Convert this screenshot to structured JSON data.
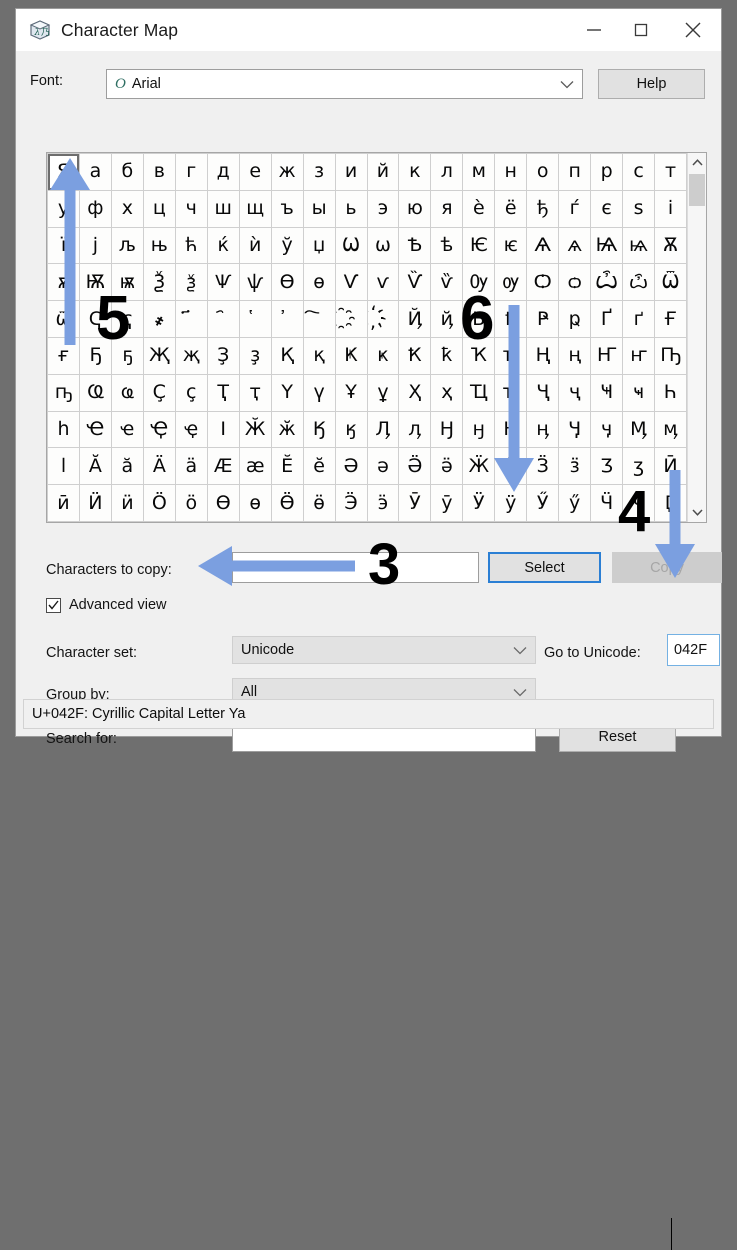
{
  "window": {
    "title": "Character Map",
    "icon": "character-map-icon",
    "controls": {
      "minimize": "minimize-icon",
      "maximize": "maximize-icon",
      "close": "close-icon"
    }
  },
  "font_row": {
    "label": "Font:",
    "value": "Arial",
    "value_prefix_glyph": "O",
    "dropdown_icon": "chevron-down-icon",
    "help_label": "Help"
  },
  "grid": {
    "columns": 20,
    "rows": 10,
    "selected_index": 0,
    "scrollbar": {
      "up_icon": "chevron-up-icon",
      "down_icon": "chevron-down-icon"
    },
    "cells": [
      "Я",
      "а",
      "б",
      "в",
      "г",
      "д",
      "е",
      "ж",
      "з",
      "и",
      "й",
      "к",
      "л",
      "м",
      "н",
      "о",
      "п",
      "р",
      "с",
      "т",
      "у",
      "ф",
      "х",
      "ц",
      "ч",
      "ш",
      "щ",
      "ъ",
      "ы",
      "ь",
      "э",
      "ю",
      "я",
      "ѐ",
      "ё",
      "ђ",
      "ѓ",
      "є",
      "ѕ",
      "і",
      "ї",
      "ј",
      "љ",
      "њ",
      "ћ",
      "ќ",
      "ѝ",
      "ў",
      "џ",
      "Ѡ",
      "ѡ",
      "Ѣ",
      "ѣ",
      "Ѥ",
      "ѥ",
      "Ѧ",
      "ѧ",
      "Ѩ",
      "ѩ",
      "Ѫ",
      "ѫ",
      "Ѭ",
      "ѭ",
      "Ѯ",
      "ѯ",
      "Ѱ",
      "ѱ",
      "Ѳ",
      "ѳ",
      "Ѵ",
      "ѵ",
      "Ѷ",
      "ѷ",
      "Ѹ",
      "ѹ",
      "Ѻ",
      "ѻ",
      "Ѽ",
      "ѽ",
      "Ѿ",
      "ѿ",
      "Ҁ",
      "ҁ",
      "҂",
      "҃",
      "҄",
      "҅",
      "҆",
      "҇",
      "҈",
      "҉",
      "Ҋ",
      "ҋ",
      "Ҍ",
      "ҍ",
      "Ҏ",
      "ҏ",
      "Ґ",
      "ґ",
      "Ғ",
      "ғ",
      "Ҕ",
      "ҕ",
      "Җ",
      "җ",
      "Ҙ",
      "ҙ",
      "Қ",
      "қ",
      "Ҝ",
      "ҝ",
      "Ҟ",
      "ҟ",
      "Ҡ",
      "ҡ",
      "Ң",
      "ң",
      "Ҥ",
      "ҥ",
      "Ҧ",
      "ҧ",
      "Ҩ",
      "ҩ",
      "Ҫ",
      "ҫ",
      "Ҭ",
      "ҭ",
      "Ү",
      "ү",
      "Ұ",
      "ұ",
      "Ҳ",
      "ҳ",
      "Ҵ",
      "ҵ",
      "Ҷ",
      "ҷ",
      "Ҹ",
      "ҹ",
      "Һ",
      "һ",
      "Ҽ",
      "ҽ",
      "Ҿ",
      "ҿ",
      "Ӏ",
      "Ӂ",
      "ӂ",
      "Ӄ",
      "ӄ",
      "Ӆ",
      "ӆ",
      "Ӈ",
      "ӈ",
      "Ӊ",
      "ӊ",
      "Ӌ",
      "ӌ",
      "Ӎ",
      "ӎ",
      "ӏ",
      "Ӑ",
      "ӑ",
      "Ӓ",
      "ӓ",
      "Ӕ",
      "ӕ",
      "Ӗ",
      "ӗ",
      "Ә",
      "ә",
      "Ӛ",
      "ӛ",
      "Ӝ",
      "ӝ",
      "Ӟ",
      "ӟ",
      "Ӡ",
      "ӡ",
      "Ӣ",
      "ӣ",
      "Ӥ",
      "ӥ",
      "Ӧ",
      "ӧ",
      "Ө",
      "ө",
      "Ӫ",
      "ӫ",
      "Ӭ",
      "ӭ",
      "Ӯ",
      "ӯ",
      "Ӱ",
      "ӱ",
      "Ӳ",
      "ӳ",
      "Ӵ",
      "ӵ",
      "Ӷ"
    ]
  },
  "controls": {
    "chars_to_copy_label": "Characters to copy:",
    "chars_to_copy_value": "",
    "select_label": "Select",
    "copy_label": "Copy",
    "copy_disabled": true,
    "advanced_view_label": "Advanced view",
    "advanced_view_checked": true,
    "character_set_label": "Character set:",
    "character_set_value": "Unicode",
    "goto_unicode_label": "Go to Unicode:",
    "goto_unicode_value": "042F",
    "group_by_label": "Group by:",
    "group_by_value": "All",
    "search_for_label": "Search for:",
    "search_for_value": "",
    "reset_label": "Reset"
  },
  "status": {
    "text": "U+042F: Cyrillic Capital Letter Ya"
  },
  "annotations": {
    "arrow_color": "#7b9fe0",
    "items": [
      {
        "number": "3",
        "direction": "left",
        "target": "advanced-view-checkbox"
      },
      {
        "number": "4",
        "direction": "down",
        "target": "goto-unicode-input"
      },
      {
        "number": "5",
        "direction": "up",
        "target": "character-grid-first-cell"
      },
      {
        "number": "6",
        "direction": "down",
        "target": "select-button"
      }
    ]
  }
}
